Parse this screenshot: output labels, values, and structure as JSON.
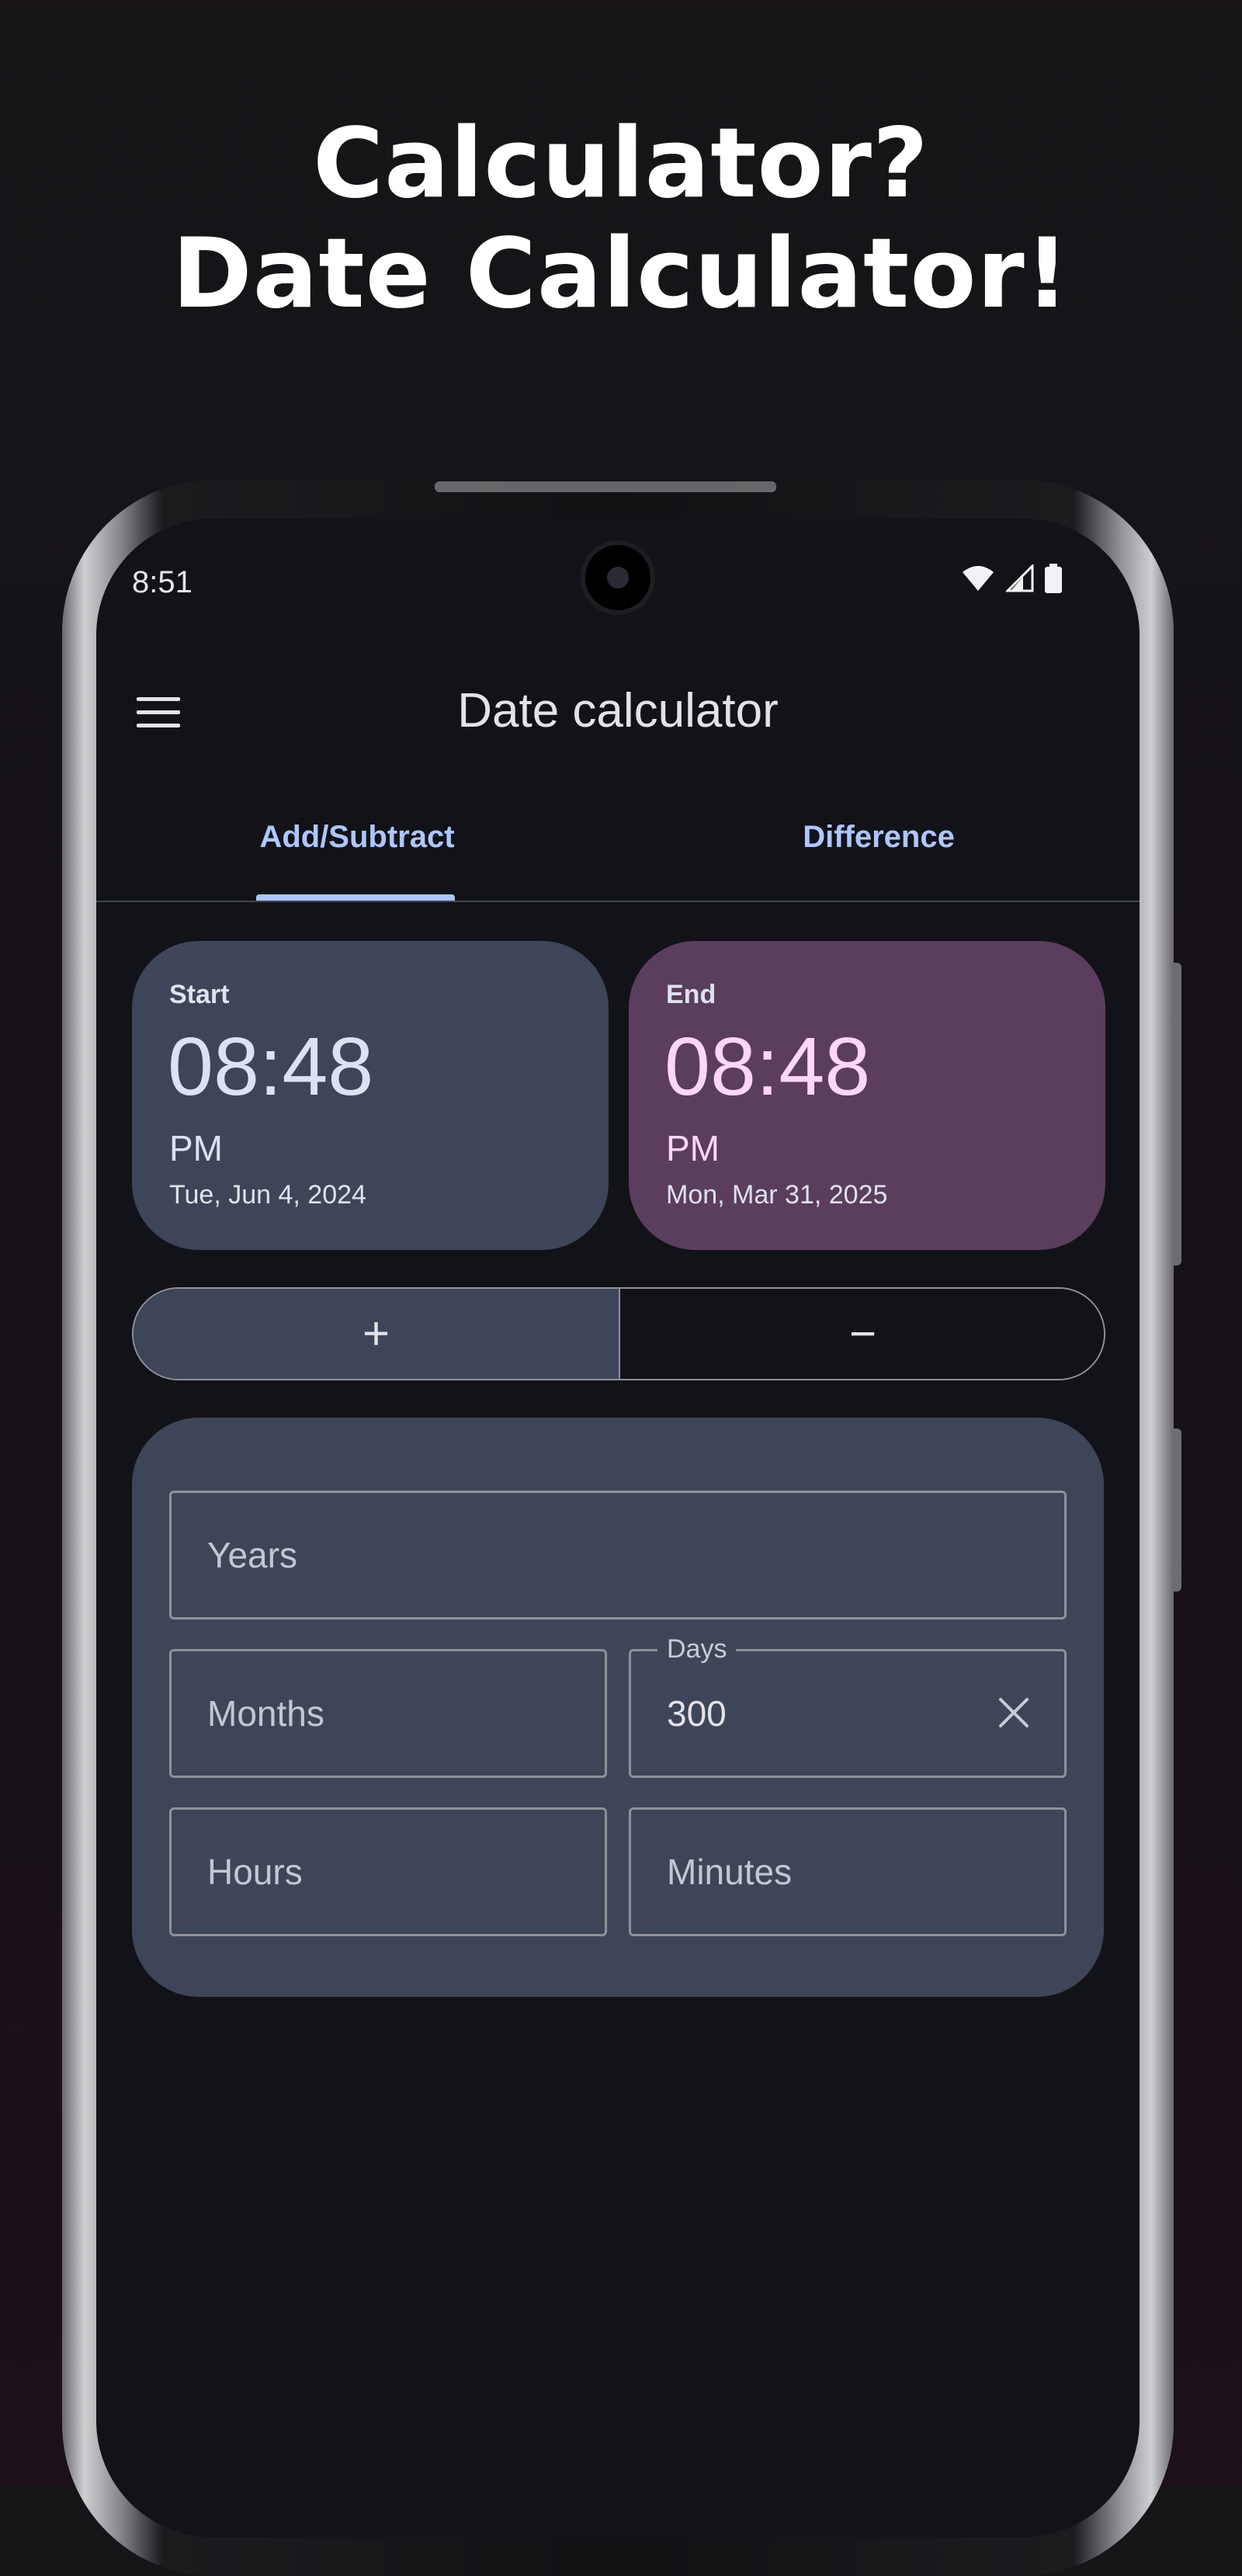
{
  "headline": {
    "line1": "Calculator?",
    "line2": "Date Calculator!"
  },
  "status_bar": {
    "time": "8:51",
    "icons": [
      "wifi-icon",
      "signal-icon",
      "battery-icon"
    ]
  },
  "app_bar": {
    "title": "Date calculator",
    "menu_icon": "menu-icon"
  },
  "tabs": [
    {
      "label": "Add/Subtract",
      "selected": true
    },
    {
      "label": "Difference",
      "selected": false
    }
  ],
  "start_card": {
    "label": "Start",
    "time": "08:48",
    "ampm": "PM",
    "date": "Tue, Jun 4, 2024"
  },
  "end_card": {
    "label": "End",
    "time": "08:48",
    "ampm": "PM",
    "date": "Mon, Mar 31, 2025"
  },
  "operation": {
    "plus": "+",
    "minus": "−",
    "selected": "plus"
  },
  "fields": {
    "years": {
      "placeholder": "Years"
    },
    "months": {
      "placeholder": "Months"
    },
    "days": {
      "label": "Days",
      "value": "300"
    },
    "hours": {
      "placeholder": "Hours"
    },
    "minutes": {
      "placeholder": "Minutes"
    }
  },
  "colors": {
    "accent": "#aec6ff",
    "start_card": "#3f4558",
    "end_card": "#5b3d5e",
    "surface": "#121318"
  }
}
